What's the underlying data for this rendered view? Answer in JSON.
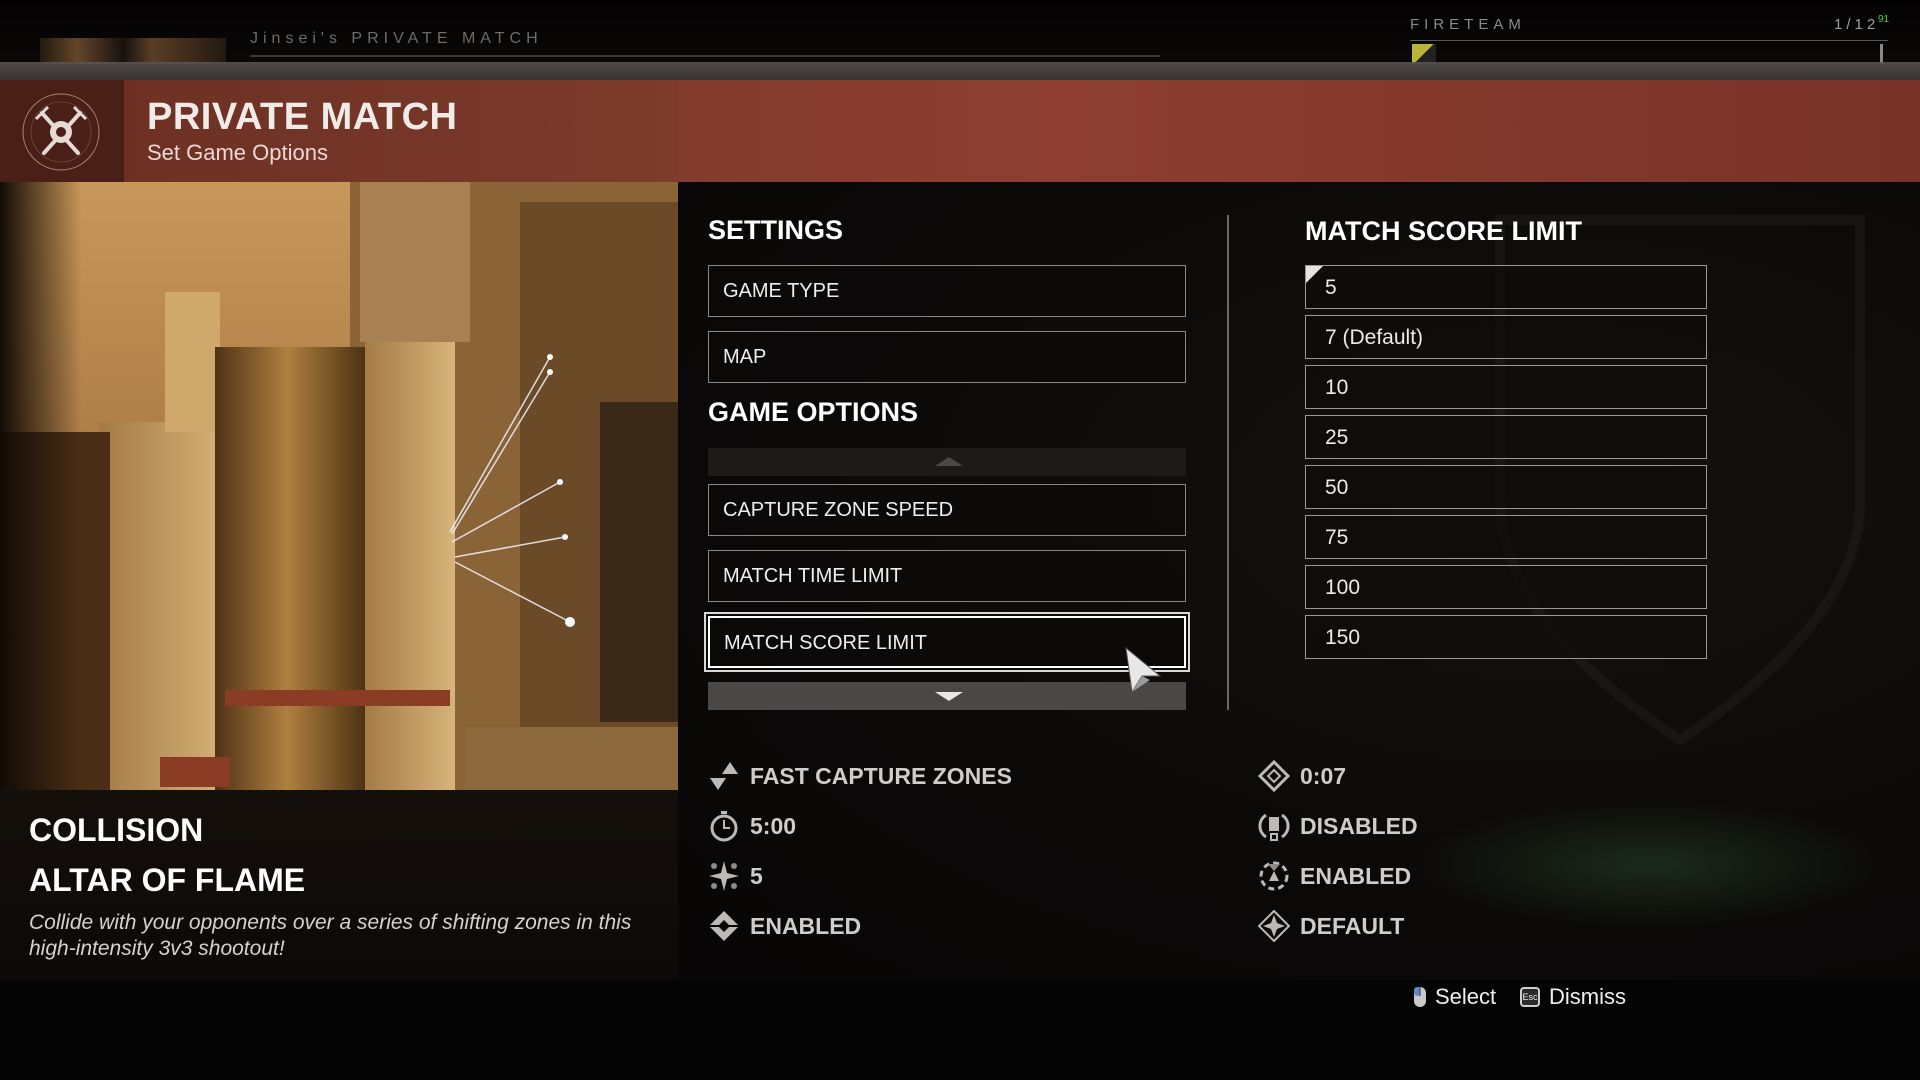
{
  "lobby": {
    "title": "Jinsei's PRIVATE MATCH",
    "fireteam_label": "FIRETEAM",
    "fireteam_count": "1/12",
    "ping": "91"
  },
  "header": {
    "icon": "crossed-swords-gear-icon",
    "title": "PRIVATE MATCH",
    "subtitle": "Set Game Options"
  },
  "activity": {
    "mode": "COLLISION",
    "map": "ALTAR OF FLAME",
    "description": "Collide with your opponents over a series of shifting zones in this high-intensity 3v3 shootout!"
  },
  "settings": {
    "title": "SETTINGS",
    "items": [
      {
        "label": "GAME TYPE"
      },
      {
        "label": "MAP"
      }
    ]
  },
  "game_options": {
    "title": "GAME OPTIONS",
    "items": [
      {
        "label": "CAPTURE ZONE SPEED"
      },
      {
        "label": "MATCH TIME LIMIT"
      },
      {
        "label": "MATCH SCORE LIMIT",
        "selected": true
      }
    ]
  },
  "score_limit": {
    "title": "MATCH SCORE LIMIT",
    "current": "5",
    "options": [
      "5",
      "7 (Default)",
      "10",
      "25",
      "50",
      "75",
      "100",
      "150"
    ]
  },
  "summary": {
    "left": [
      {
        "icon": "capture-speed-icon",
        "value": "FAST CAPTURE ZONES"
      },
      {
        "icon": "stopwatch-icon",
        "value": "5:00"
      },
      {
        "icon": "score-star-icon",
        "value": "5"
      },
      {
        "icon": "diamond-eye-icon",
        "value": "ENABLED"
      }
    ],
    "right": [
      {
        "icon": "respawn-diamond-icon",
        "value": "0:07"
      },
      {
        "icon": "vehicle-icon",
        "value": "DISABLED"
      },
      {
        "icon": "heavy-ammo-icon",
        "value": "ENABLED"
      },
      {
        "icon": "power-compass-icon",
        "value": "DEFAULT"
      }
    ]
  },
  "footer": {
    "select_label": "Select",
    "dismiss_label": "Dismiss",
    "esc_key": "Esc"
  }
}
